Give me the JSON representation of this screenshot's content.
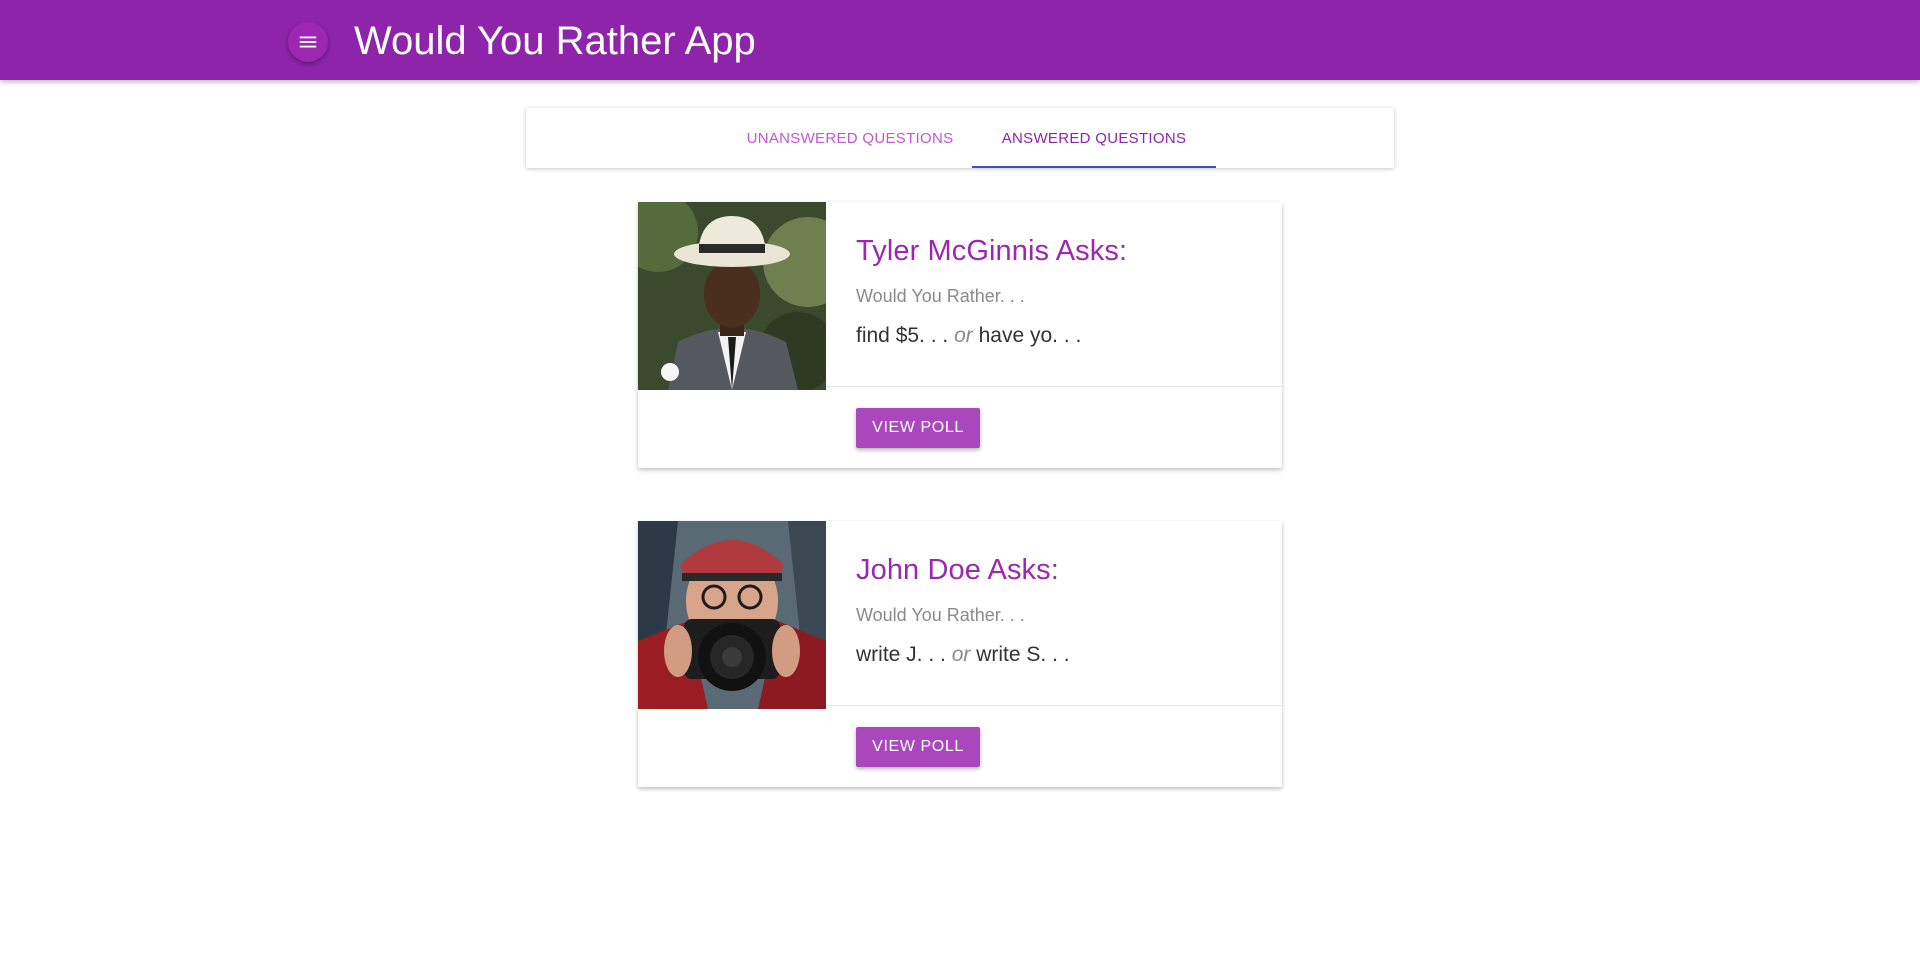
{
  "app": {
    "title": "Would You Rather App",
    "menu_icon": "hamburger-menu-icon",
    "accent_color": "#8e24aa",
    "button_color": "#ab47bc"
  },
  "tabs": [
    {
      "label": "UNANSWERED QUESTIONS",
      "selected": false
    },
    {
      "label": "ANSWERED QUESTIONS",
      "selected": true
    }
  ],
  "questions": [
    {
      "asker": "Tyler McGinnis Asks:",
      "prompt": "Would You Rather. . .",
      "option_one": "find $5. . .",
      "or_word": "or",
      "option_two": "have yo. . .",
      "button_label": "VIEW POLL"
    },
    {
      "asker": "John Doe Asks:",
      "prompt": "Would You Rather. . .",
      "option_one": "write J. . .",
      "or_word": "or",
      "option_two": "write S. . .",
      "button_label": "VIEW POLL"
    }
  ]
}
